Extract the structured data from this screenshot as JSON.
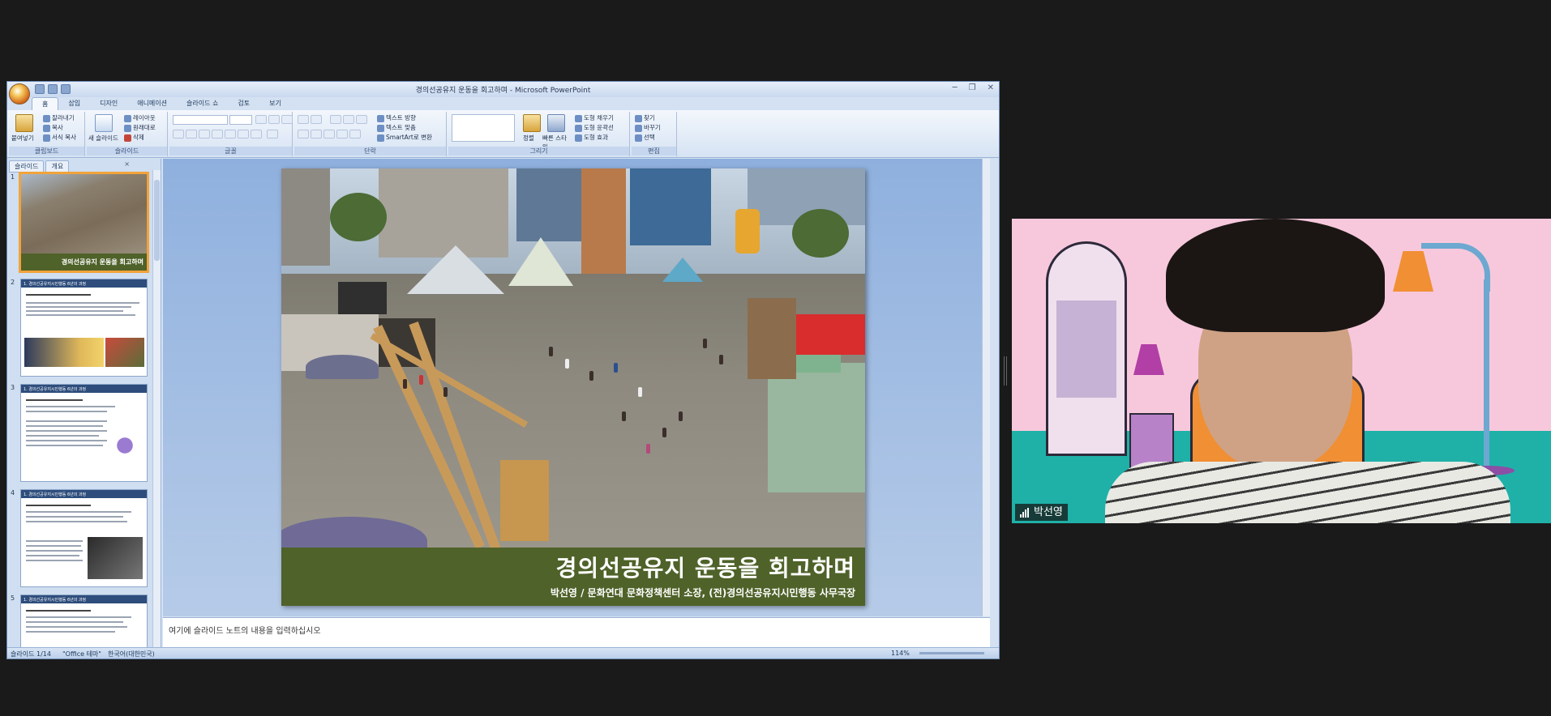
{
  "window": {
    "title": "경의선공유지 운동을 회고하며 - Microsoft PowerPoint",
    "controls": [
      "─",
      "❐",
      "✕"
    ]
  },
  "ribbon": {
    "tabs": [
      "홈",
      "삽입",
      "디자인",
      "애니메이션",
      "슬라이드 쇼",
      "검토",
      "보기"
    ],
    "clipboard": {
      "paste": "붙여넣기",
      "cut": "잘라내기",
      "copy": "복사",
      "format_painter": "서식 복사",
      "label": "클립보드"
    },
    "slides": {
      "new_slide": "새 슬라이드",
      "layout": "레이아웃",
      "reset": "원래대로",
      "delete": "삭제",
      "label": "슬라이드"
    },
    "font": {
      "label": "글꼴"
    },
    "paragraph": {
      "text_direction": "텍스트 방향",
      "align_text": "텍스트 맞춤",
      "smartart": "SmartArt로 변환",
      "label": "단락"
    },
    "drawing": {
      "arrange": "정렬",
      "quick_styles": "빠른 스타일",
      "fill": "도형 채우기",
      "outline": "도형 윤곽선",
      "effects": "도형 효과",
      "label": "그리기"
    },
    "editing": {
      "find": "찾기",
      "replace": "바꾸기",
      "select": "선택",
      "label": "편집"
    }
  },
  "left_pane": {
    "tabs": [
      "슬라이드",
      "개요"
    ],
    "close": "×",
    "thumbnails": [
      {
        "number": "1",
        "caption": "경의선공유지 운동을 회고하며"
      },
      {
        "number": "2",
        "caption": "1. 경의선공유지시민행동 6년의 과정"
      },
      {
        "number": "3",
        "caption": "1. 경의선공유지시민행동 6년의 과정"
      },
      {
        "number": "4",
        "caption": "1. 경의선공유지시민행동 6년의 과정"
      },
      {
        "number": "5",
        "caption": "1. 경의선공유지시민행동 6년의 과정"
      }
    ]
  },
  "slide": {
    "title": "경의선공유지 운동을 회고하며",
    "subtitle": "박선영 / 문화연대 문화정책센터 소장, (전)경의선공유지시민행동 사무국장"
  },
  "notes": {
    "placeholder": "여기에 슬라이드 노트의 내용을 입력하십시오"
  },
  "status_bar": {
    "slide_count": "슬라이드 1/14",
    "theme": "\"Office 테마\"",
    "language": "한국어(대한민국)",
    "zoom": "114%"
  },
  "video": {
    "participant_name": "박선영"
  },
  "colors": {
    "slide_band": "#4f6229",
    "selected_thumb": "#f2a33a",
    "video_floor": "#1fb1a8",
    "video_wall": "#f7c8dc"
  }
}
